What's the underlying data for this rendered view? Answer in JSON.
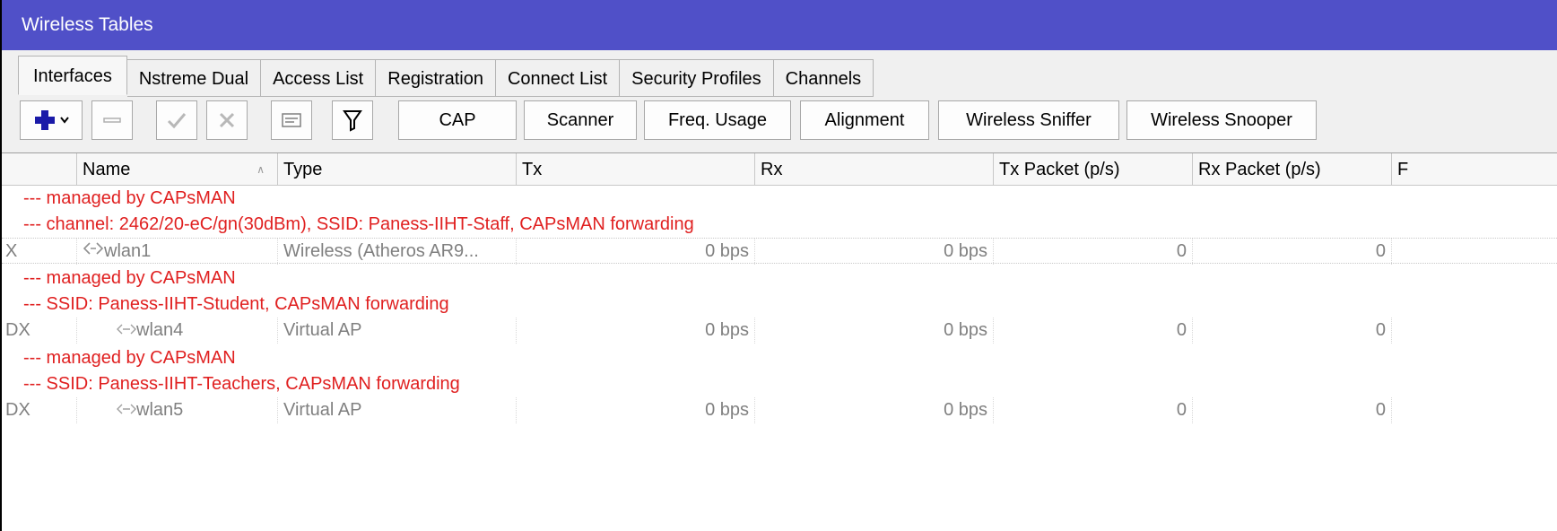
{
  "window": {
    "title": "Wireless Tables"
  },
  "tabs": [
    {
      "label": "Interfaces",
      "active": true
    },
    {
      "label": "Nstreme Dual",
      "active": false
    },
    {
      "label": "Access List",
      "active": false
    },
    {
      "label": "Registration",
      "active": false
    },
    {
      "label": "Connect List",
      "active": false
    },
    {
      "label": "Security Profiles",
      "active": false
    },
    {
      "label": "Channels",
      "active": false
    }
  ],
  "toolbar": {
    "icons": [
      "add-dropdown-icon",
      "remove-icon",
      "enable-icon",
      "disable-icon",
      "comment-icon",
      "filter-icon"
    ],
    "buttons": [
      "CAP",
      "Scanner",
      "Freq. Usage",
      "Alignment",
      "Wireless Sniffer",
      "Wireless Snooper"
    ]
  },
  "columns": [
    "Name",
    "Type",
    "Tx",
    "Rx",
    "Tx Packet (p/s)",
    "Rx Packet (p/s)",
    "F"
  ],
  "rows": [
    {
      "kind": "comment",
      "text": "--- managed by CAPsMAN"
    },
    {
      "kind": "comment",
      "text": "--- channel: 2462/20-eC/gn(30dBm), SSID: Paness-IIHT-Staff, CAPsMAN forwarding"
    },
    {
      "kind": "data",
      "flags": "X",
      "name": "wlan1",
      "icon": "wireless-interface-icon",
      "type": "Wireless (Atheros AR9...",
      "tx": "0 bps",
      "rx": "0 bps",
      "tx_packet": "0",
      "rx_packet": "0"
    },
    {
      "kind": "comment",
      "text": "--- managed by CAPsMAN"
    },
    {
      "kind": "comment",
      "text": "--- SSID: Paness-IIHT-Student, CAPsMAN forwarding"
    },
    {
      "kind": "data",
      "flags": "DX",
      "name": "wlan4",
      "icon": "virtual-ap-icon",
      "type": "Virtual AP",
      "tx": "0 bps",
      "rx": "0 bps",
      "tx_packet": "0",
      "rx_packet": "0"
    },
    {
      "kind": "comment",
      "text": "--- managed by CAPsMAN"
    },
    {
      "kind": "comment",
      "text": "--- SSID: Paness-IIHT-Teachers, CAPsMAN forwarding"
    },
    {
      "kind": "data",
      "flags": "DX",
      "name": "wlan5",
      "icon": "virtual-ap-icon",
      "type": "Virtual AP",
      "tx": "0 bps",
      "rx": "0 bps",
      "tx_packet": "0",
      "rx_packet": "0"
    }
  ],
  "colors": {
    "titlebar": "#5050c8",
    "comment": "#e02020",
    "disabled_text": "#808080",
    "add_icon": "#1a1aa8"
  }
}
